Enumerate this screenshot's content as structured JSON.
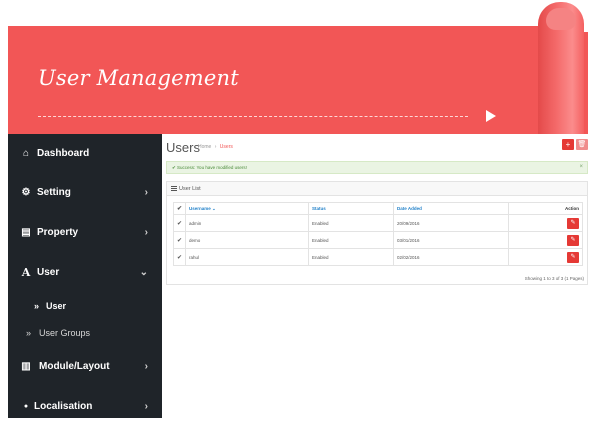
{
  "banner": {
    "title": "User Management",
    "color": "#f25656"
  },
  "sidebar": {
    "items": [
      {
        "label": "Dashboard",
        "icon": "home-icon",
        "glyph": "⌂"
      },
      {
        "label": "Setting",
        "icon": "gears-icon",
        "glyph": "⚙",
        "chevron": "›"
      },
      {
        "label": "Property",
        "icon": "file-icon",
        "glyph": "▤",
        "chevron": "›"
      },
      {
        "label": "User",
        "icon": "font-icon",
        "glyph": "A",
        "chevron": "⌄"
      },
      {
        "label": "Module/Layout",
        "icon": "chart-icon",
        "glyph": "▥",
        "chevron": "›"
      },
      {
        "label": "Localisation",
        "icon": "map-marker-icon",
        "glyph": "●",
        "chevron": "›"
      }
    ],
    "subitems": [
      {
        "label": "User",
        "glyph": "»",
        "active": true
      },
      {
        "label": "User Groups",
        "glyph": "»",
        "active": false
      }
    ]
  },
  "main": {
    "title": "Users",
    "breadcrumb": [
      "Home",
      "Users"
    ],
    "breadcrumb_sep": "›",
    "add_glyph": "+",
    "delete_glyph": "🗑",
    "alert": "Success: You have modified users!",
    "alert_glyph": "✔",
    "alert_close": "×",
    "panel_title": "User List",
    "columns": {
      "check": "✔",
      "username": "Username ⌄",
      "status": "Status",
      "date": "Date Added",
      "action": "Action"
    },
    "rows": [
      {
        "check": "✔",
        "username": "admin",
        "status": "Enabled",
        "date": "20/09/2016"
      },
      {
        "check": "✔",
        "username": "demo",
        "status": "Enabled",
        "date": "03/01/2016"
      },
      {
        "check": "✔",
        "username": "rahul",
        "status": "Enabled",
        "date": "02/02/2016"
      }
    ],
    "edit_glyph": "✎",
    "footer": "Showing 1 to 3 of 3 (1 Pages)"
  }
}
